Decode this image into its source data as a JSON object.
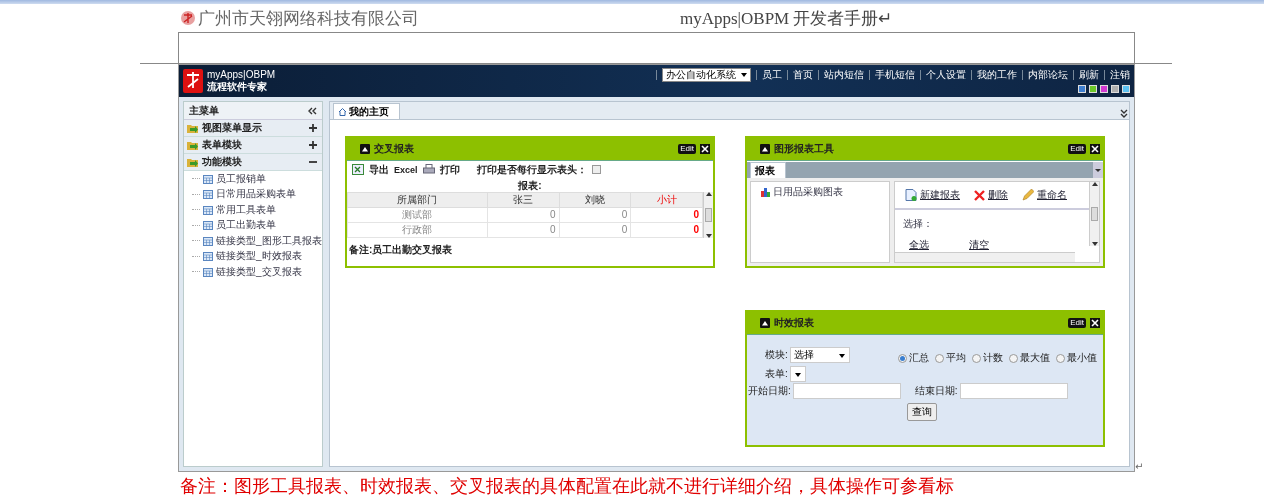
{
  "document_header": {
    "company": "广州市天翎网络科技有限公司",
    "title": "myApps|OBPM 开发者手册↵"
  },
  "app": {
    "logo": {
      "name": "myApps|OBPM",
      "slogan": "流程软件专家"
    },
    "system_select": "办公自动化系统",
    "nav_links": [
      "员工",
      "首页",
      "站内短信",
      "手机短信",
      "个人设置",
      "我的工作",
      "内部论坛",
      "刷新",
      "注销"
    ],
    "theme_swatches": [
      {
        "color": "#3f7fd0"
      },
      {
        "color": "#6cc829"
      },
      {
        "color": "#d23ad2"
      },
      {
        "color": "#b0b0b0"
      },
      {
        "color": "#5cc0f0"
      }
    ],
    "sidebar": {
      "title": "主菜单",
      "groups": [
        {
          "label": "视图菜单显示",
          "expanded": false
        },
        {
          "label": "表单模块",
          "expanded": false
        },
        {
          "label": "功能模块",
          "expanded": true,
          "children": [
            "员工报销单",
            "日常用品采购表单",
            "常用工具表单",
            "员工出勤表单",
            "链接类型_图形工具报表",
            "链接类型_时效报表",
            "链接类型_交叉报表"
          ]
        }
      ]
    },
    "tabs": [
      {
        "label": "我的主页",
        "selected": true
      }
    ],
    "panels": [
      {
        "kind": "cross_report",
        "title": "交叉报表",
        "edit": "Edit",
        "export": "导出",
        "export_format": "Excel",
        "print": "打印",
        "print_header_label": "打印是否每行显示表头：",
        "print_header_checked": false,
        "caption": "报表:",
        "columns": [
          "所属部门",
          "张三",
          "刘晓",
          "小计"
        ],
        "rows": [
          [
            "测试部",
            "0",
            "0",
            "0"
          ],
          [
            "行政部",
            "0",
            "0",
            "0"
          ]
        ],
        "remark": "备注:员工出勤交叉报表"
      },
      {
        "kind": "chart_tool",
        "title": "图形报表工具",
        "edit": "Edit",
        "tabs": [
          {
            "label": "报表",
            "selected": true
          }
        ],
        "tree_items": [
          "日用品采购图表"
        ],
        "actions": [
          "新建报表",
          "删除",
          "重命名"
        ],
        "select_label": "选择：",
        "select_links": [
          "全选",
          "清空"
        ]
      },
      {
        "kind": "timing_report",
        "title": "时效报表",
        "edit": "Edit",
        "module_label": "模块:",
        "module_value": "选择",
        "form_label": "表单:",
        "radios": [
          {
            "label": "汇总",
            "selected": true
          },
          {
            "label": "平均",
            "selected": false
          },
          {
            "label": "计数",
            "selected": false
          },
          {
            "label": "最大值",
            "selected": false
          },
          {
            "label": "最小值",
            "selected": false
          }
        ],
        "start_label": "开始日期:",
        "end_label": "结束日期:",
        "query": "查询"
      }
    ]
  },
  "paragraph_mark": "↵",
  "note": "备注：图形工具报表、时效报表、交叉报表的具体配置在此就不进行详细介绍，具体操作可参看标"
}
